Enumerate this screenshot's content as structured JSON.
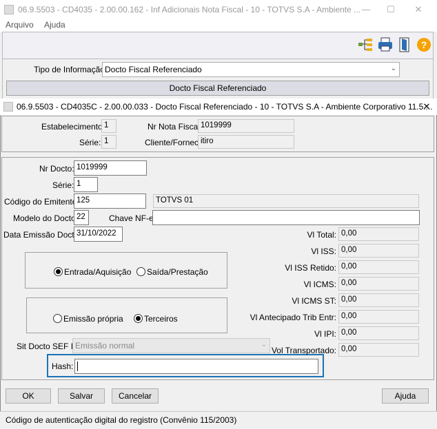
{
  "parent_window": {
    "title": "06.9.5503 - CD4035 - 2.00.00.162 - Inf Adicionais Nota Fiscal - 10 - TOTVS S.A - Ambiente ...",
    "menu": [
      "Arquivo",
      "Ajuda"
    ],
    "tipo_label": "Tipo de Informação:",
    "tipo_value": "Docto Fiscal Referenciado",
    "section_header": "Docto Fiscal Referenciado"
  },
  "dialog": {
    "title": "06.9.5503 - CD4035C - 2.00.00.033 - Docto Fiscal Referenciado - 10 - TOTVS S.A - Ambiente Corporativo 11.5....",
    "header": {
      "estabelecimento_label": "Estabelecimento:",
      "estabelecimento_value": "1",
      "serie_label": "Série:",
      "serie_value": "1",
      "nr_nota_label": "Nr Nota Fiscal:",
      "nr_nota_value": "1019999",
      "cliente_label": "Cliente/Fornec:",
      "cliente_value": "itiro"
    },
    "form": {
      "nr_docto_label": "Nr Docto:",
      "nr_docto_value": "1019999",
      "serie_label": "Série:",
      "serie_value": "1",
      "cod_emitente_label": "Código do Emitente:",
      "cod_emitente_value": "125",
      "emitente_nome": "TOTVS 01",
      "modelo_label": "Modelo do Docto:",
      "modelo_value": "22",
      "chave_label": "Chave NF-e:",
      "chave_value": "",
      "data_label": "Data Emissão Docto:",
      "data_value": "31/10/2022",
      "radio_group1": [
        "Entrada/Aquisição",
        "Saída/Prestação"
      ],
      "radio_group2": [
        "Emissão própria",
        "Terceiros"
      ],
      "sit_label": "Sit Docto SEF II:",
      "sit_value": "Emissão normal",
      "hash_label": "Hash:",
      "hash_value": "",
      "values": [
        {
          "label": "Vl Total:",
          "value": "0,00"
        },
        {
          "label": "Vl ISS:",
          "value": "0,00"
        },
        {
          "label": "Vl ISS Retido:",
          "value": "0,00"
        },
        {
          "label": "Vl ICMS:",
          "value": "0,00"
        },
        {
          "label": "Vl ICMS ST:",
          "value": "0,00"
        },
        {
          "label": "Vl Antecipado Trib Entr:",
          "value": "0,00"
        },
        {
          "label": "Vl IPI:",
          "value": "0,00"
        },
        {
          "label": "Vol Transportado:",
          "value": "0,00"
        }
      ]
    },
    "buttons": {
      "ok": "OK",
      "salvar": "Salvar",
      "cancelar": "Cancelar",
      "ajuda": "Ajuda"
    },
    "status": "Código de autenticação digital do registro (Convênio 115/2003)"
  },
  "colors": {
    "focus_border": "#1a73b5"
  }
}
